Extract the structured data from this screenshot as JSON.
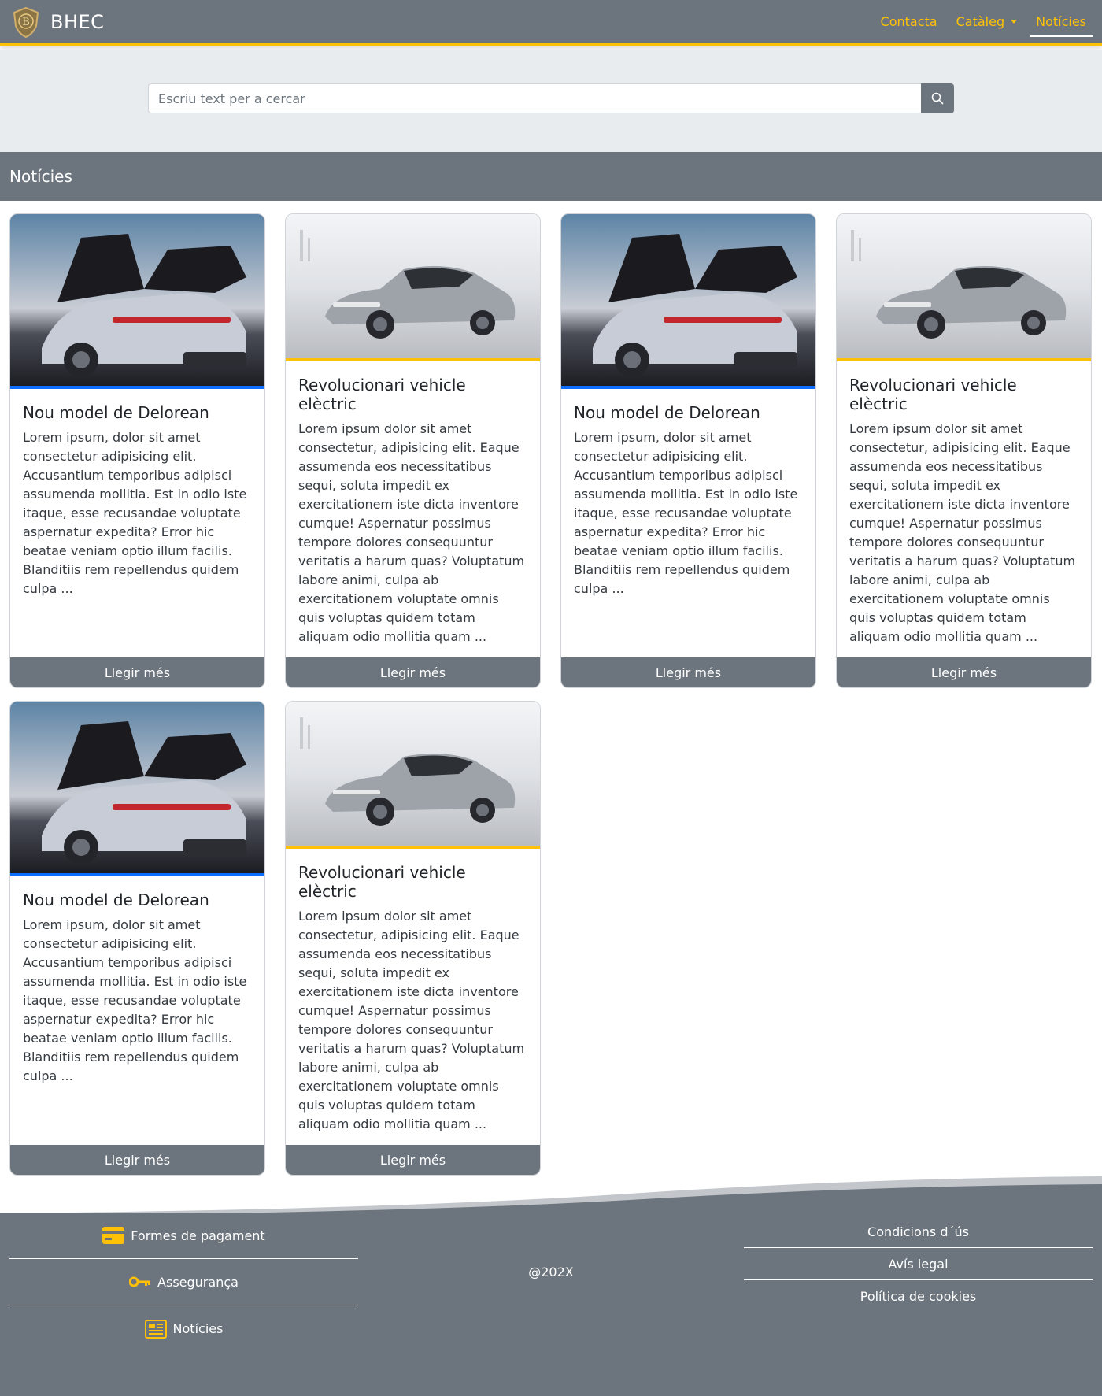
{
  "navbar": {
    "brand": "BHEC",
    "logo_icon": "shield-logo-icon",
    "links": [
      {
        "label": "Contacta"
      },
      {
        "label": "Catàleg"
      },
      {
        "label": "Notícies"
      }
    ],
    "accent_color": "#ffc107",
    "background_color": "#6c757d"
  },
  "search": {
    "placeholder": "Escriu text per a cercar",
    "button_icon": "search-icon"
  },
  "section": {
    "title": "Notícies"
  },
  "cards": [
    {
      "title": "Nou model de Delorean",
      "text": "Lorem ipsum, dolor sit amet consectetur adipisicing elit. Accusantium temporibus adipisci assumenda mollitia. Est in odio iste itaque, esse recusandae voluptate aspernatur expedita? Error hic beatae veniam optio illum facilis. Blanditiis rem repellendus quidem culpa ...",
      "button": "Llegir més",
      "image": "delorean-car-image",
      "accent": "#0d6efd"
    },
    {
      "title": "Revolucionari vehicle elèctric",
      "text": "Lorem ipsum dolor sit amet consectetur, adipisicing elit. Eaque assumenda eos necessitatibus sequi, soluta impedit ex exercitationem iste dicta inventore cumque! Aspernatur possimus tempore dolores consequuntur veritatis a harum quas? Voluptatum labore animi, culpa ab exercitationem voluptate omnis quis voluptas quidem totam aliquam odio mollitia quam ...",
      "button": "Llegir més",
      "image": "electric-car-image",
      "accent": "#ffc107"
    },
    {
      "title": "Nou model de Delorean",
      "text": "Lorem ipsum, dolor sit amet consectetur adipisicing elit. Accusantium temporibus adipisci assumenda mollitia. Est in odio iste itaque, esse recusandae voluptate aspernatur expedita? Error hic beatae veniam optio illum facilis. Blanditiis rem repellendus quidem culpa ...",
      "button": "Llegir més",
      "image": "delorean-car-image",
      "accent": "#0d6efd"
    },
    {
      "title": "Revolucionari vehicle elèctric",
      "text": "Lorem ipsum dolor sit amet consectetur, adipisicing elit. Eaque assumenda eos necessitatibus sequi, soluta impedit ex exercitationem iste dicta inventore cumque! Aspernatur possimus tempore dolores consequuntur veritatis a harum quas? Voluptatum labore animi, culpa ab exercitationem voluptate omnis quis voluptas quidem totam aliquam odio mollitia quam ...",
      "button": "Llegir més",
      "image": "electric-car-image",
      "accent": "#ffc107"
    },
    {
      "title": "Nou model de Delorean",
      "text": "Lorem ipsum, dolor sit amet consectetur adipisicing elit. Accusantium temporibus adipisci assumenda mollitia. Est in odio iste itaque, esse recusandae voluptate aspernatur expedita? Error hic beatae veniam optio illum facilis. Blanditiis rem repellendus quidem culpa ...",
      "button": "Llegir més",
      "image": "delorean-car-image",
      "accent": "#0d6efd"
    },
    {
      "title": "Revolucionari vehicle elèctric",
      "text": "Lorem ipsum dolor sit amet consectetur, adipisicing elit. Eaque assumenda eos necessitatibus sequi, soluta impedit ex exercitationem iste dicta inventore cumque! Aspernatur possimus tempore dolores consequuntur veritatis a harum quas? Voluptatum labore animi, culpa ab exercitationem voluptate omnis quis voluptas quidem totam aliquam odio mollitia quam ...",
      "button": "Llegir més",
      "image": "electric-car-image",
      "accent": "#ffc107"
    }
  ],
  "footer": {
    "left": [
      {
        "label": "Formes de pagament",
        "icon": "credit-card-icon"
      },
      {
        "label": "Assegurança",
        "icon": "key-icon"
      },
      {
        "label": "Notícies",
        "icon": "newspaper-icon"
      }
    ],
    "copyright": "@202X",
    "right": [
      {
        "label": "Condicions d´ús"
      },
      {
        "label": "Avís legal"
      },
      {
        "label": "Política de cookies"
      }
    ]
  }
}
